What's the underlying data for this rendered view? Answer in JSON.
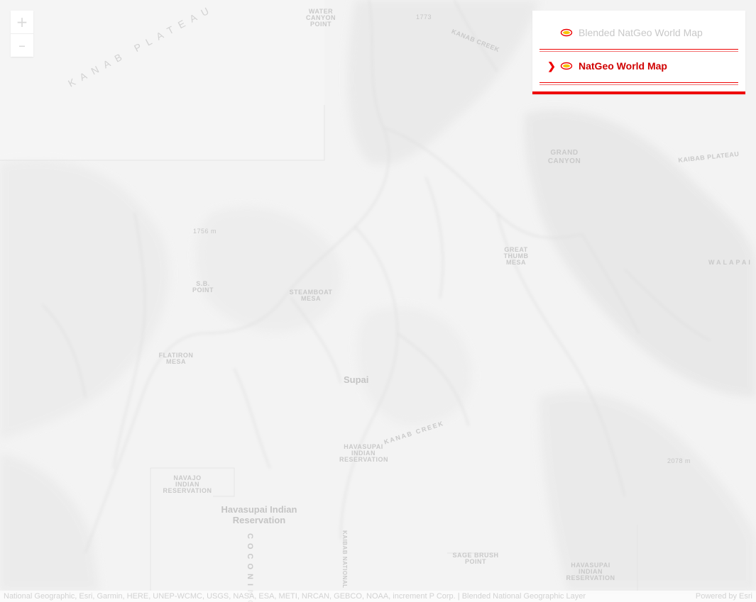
{
  "zoom": {
    "zoom_in_label": "+",
    "zoom_out_label": "–"
  },
  "layer_list": {
    "items": [
      {
        "title": "Blended NatGeo World Map",
        "visible_icon": "eye-icon",
        "selected": false
      },
      {
        "title": "NatGeo World Map",
        "visible_icon": "eye-icon",
        "caret_icon": "chevron-right-icon",
        "selected": true
      }
    ],
    "accent_color": "#ee0000"
  },
  "map_labels": {
    "kanab_plateau": "KANAB PLATEAU",
    "water_canyon_point": "WATER\nCANYON\nPOINT",
    "elev_1773": "1773",
    "grand_canyon": "GRAND\nCANYON",
    "kanab_creek": "KANAB CREEK",
    "elev_1756": "1756 m",
    "sb_point": "S.B.\nPOINT",
    "steamboat_mesa": "STEAMBOAT\nMESA",
    "great_thumb_mesa": "GREAT\nTHUMB\nMESA",
    "kaibab_plateau": "KAIBAB PLATEAU",
    "supai": "Supai",
    "flatiron": "FLATIRON\nMESA",
    "havasupai_indian_reservation_east": "HAVASUPAI\nINDIAN\nRESERVATION",
    "navajo_indian_reservation": "NAVAJO\nINDIAN\nRESERVATION",
    "havasupai_indian_reservation": "Havasupai Indian\nReservation",
    "elev_2078": "2078 m",
    "sage_brush_point": "SAGE BRUSH\nPOINT",
    "havasupai_indian_reservation_se": "HAVASUPAI\nINDIAN\nRESERVATION",
    "coconino": "COCONINO",
    "kaibab_national_forest": "KAIBAB NATIONAL",
    "walapai": "WALAPAI",
    "kanab_creek_west": "KANAB CREEK"
  },
  "attribution": {
    "text": "National Geographic, Esri, Garmin, HERE, UNEP-WCMC, USGS, NASA, ESA, METI, NRCAN, GEBCO, NOAA, increment P Corp. | Blended National Geographic Layer",
    "powered_by": "Powered by Esri"
  }
}
